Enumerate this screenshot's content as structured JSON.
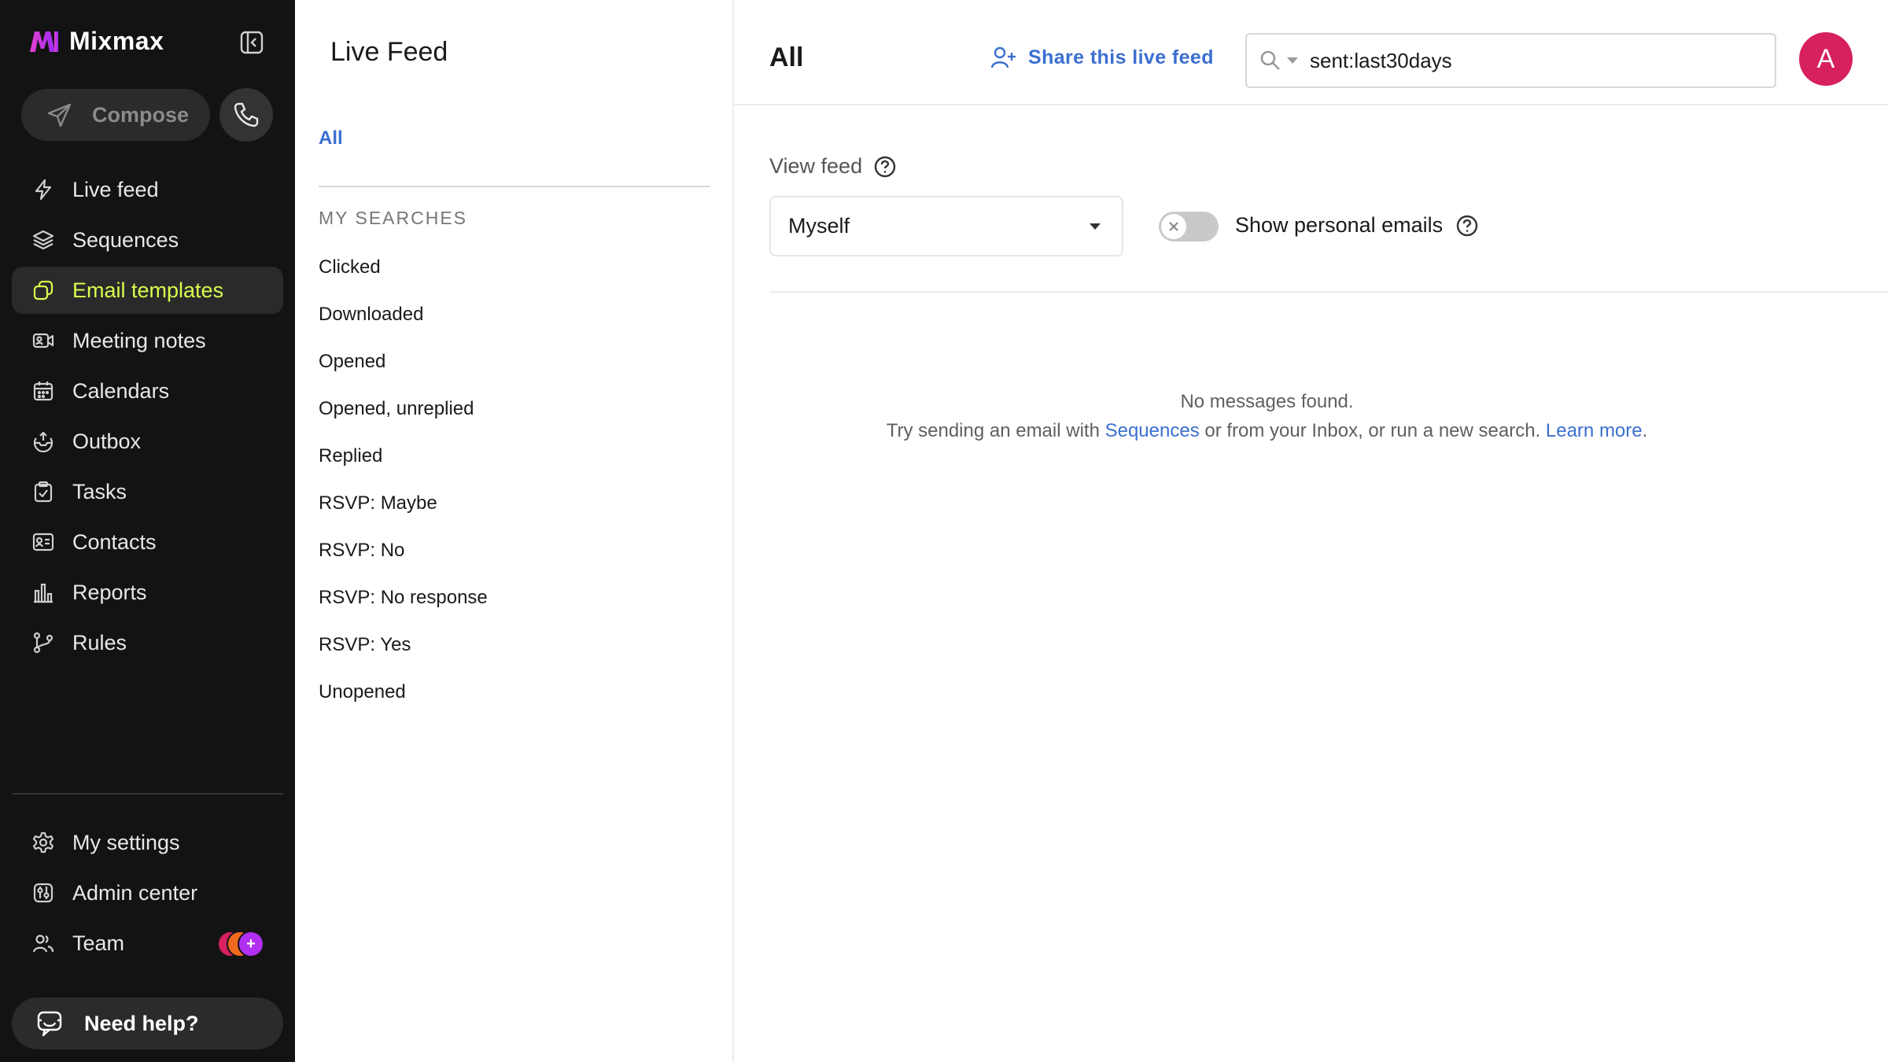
{
  "brand": {
    "name": "Mixmax",
    "accent": "#c12cf0"
  },
  "nav": {
    "compose_label": "Compose",
    "items": [
      {
        "label": "Live feed",
        "icon": "bolt-icon"
      },
      {
        "label": "Sequences",
        "icon": "layers-icon"
      },
      {
        "label": "Email templates",
        "icon": "templates-icon",
        "active": true
      },
      {
        "label": "Meeting notes",
        "icon": "meeting-notes-icon"
      },
      {
        "label": "Calendars",
        "icon": "calendar-icon"
      },
      {
        "label": "Outbox",
        "icon": "outbox-icon"
      },
      {
        "label": "Tasks",
        "icon": "tasks-icon"
      },
      {
        "label": "Contacts",
        "icon": "contacts-icon"
      },
      {
        "label": "Reports",
        "icon": "reports-icon"
      },
      {
        "label": "Rules",
        "icon": "rules-icon"
      }
    ],
    "bottom": [
      {
        "label": "My settings",
        "icon": "gear-icon"
      },
      {
        "label": "Admin center",
        "icon": "admin-icon"
      },
      {
        "label": "Team",
        "icon": "team-icon"
      }
    ],
    "help_label": "Need help?",
    "active_color": "#d9ff4f"
  },
  "mid": {
    "title": "Live Feed",
    "all_label": "All",
    "heading": "MY SEARCHES",
    "searches": [
      "Clicked",
      "Downloaded",
      "Opened",
      "Opened, unreplied",
      "Replied",
      "RSVP: Maybe",
      "RSVP: No",
      "RSVP: No response",
      "RSVP: Yes",
      "Unopened"
    ]
  },
  "main": {
    "title": "All",
    "share_label": "Share this live feed",
    "search_value": "sent:last30days",
    "avatar_letter": "A",
    "avatar_color": "#d6205f",
    "view_feed_label": "View feed",
    "view_feed_value": "Myself",
    "show_personal_label": "Show personal emails",
    "toggle_on": false,
    "empty_title": "No messages found.",
    "empty_pre": "Try sending an email with ",
    "empty_link1": "Sequences",
    "empty_mid": " or from your Inbox, or run a new search. ",
    "empty_link2": "Learn more",
    "empty_post": "."
  }
}
